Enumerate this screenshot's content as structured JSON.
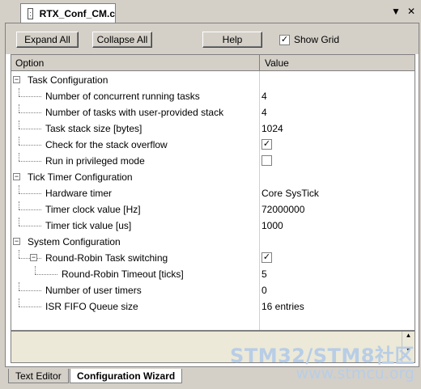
{
  "tab": {
    "title": "RTX_Conf_CM.c",
    "icon": "file-icon"
  },
  "window": {
    "menu_glyph": "▼",
    "close_glyph": "✕"
  },
  "toolbar": {
    "expand_label": "Expand All",
    "collapse_label": "Collapse All",
    "help_label": "Help",
    "showgrid_label": "Show Grid",
    "showgrid_checked": true
  },
  "grid": {
    "header": {
      "option": "Option",
      "value": "Value"
    },
    "rows": [
      {
        "label": "Task Configuration",
        "value": "",
        "level": 0,
        "expander": "minus"
      },
      {
        "label": "Number of concurrent running tasks",
        "value": "4",
        "level": 1
      },
      {
        "label": "Number of tasks with user-provided stack",
        "value": "4",
        "level": 1
      },
      {
        "label": "Task stack size [bytes]",
        "value": "1024",
        "level": 1
      },
      {
        "label": "Check for the stack overflow",
        "value": "",
        "level": 1,
        "checkbox": true,
        "checked": true
      },
      {
        "label": "Run in privileged mode",
        "value": "",
        "level": 1,
        "checkbox": true,
        "checked": false
      },
      {
        "label": "Tick Timer Configuration",
        "value": "",
        "level": 0,
        "expander": "minus"
      },
      {
        "label": "Hardware timer",
        "value": "Core SysTick",
        "level": 1
      },
      {
        "label": "Timer clock value [Hz]",
        "value": "72000000",
        "level": 1
      },
      {
        "label": "Timer tick value [us]",
        "value": "1000",
        "level": 1
      },
      {
        "label": "System Configuration",
        "value": "",
        "level": 0,
        "expander": "minus"
      },
      {
        "label": "Round-Robin Task switching",
        "value": "",
        "level": 1,
        "expander": "minus",
        "checkbox": true,
        "checked": true
      },
      {
        "label": "Round-Robin Timeout [ticks]",
        "value": "5",
        "level": 2
      },
      {
        "label": "Number of user timers",
        "value": "0",
        "level": 1
      },
      {
        "label": "ISR FIFO Queue size",
        "value": "16 entries",
        "level": 1
      }
    ]
  },
  "bottom_tabs": [
    "Text Editor",
    "Configuration Wizard"
  ],
  "watermark": {
    "line1": "STM32/STM8社区",
    "line2": "www.stmcu.org"
  }
}
